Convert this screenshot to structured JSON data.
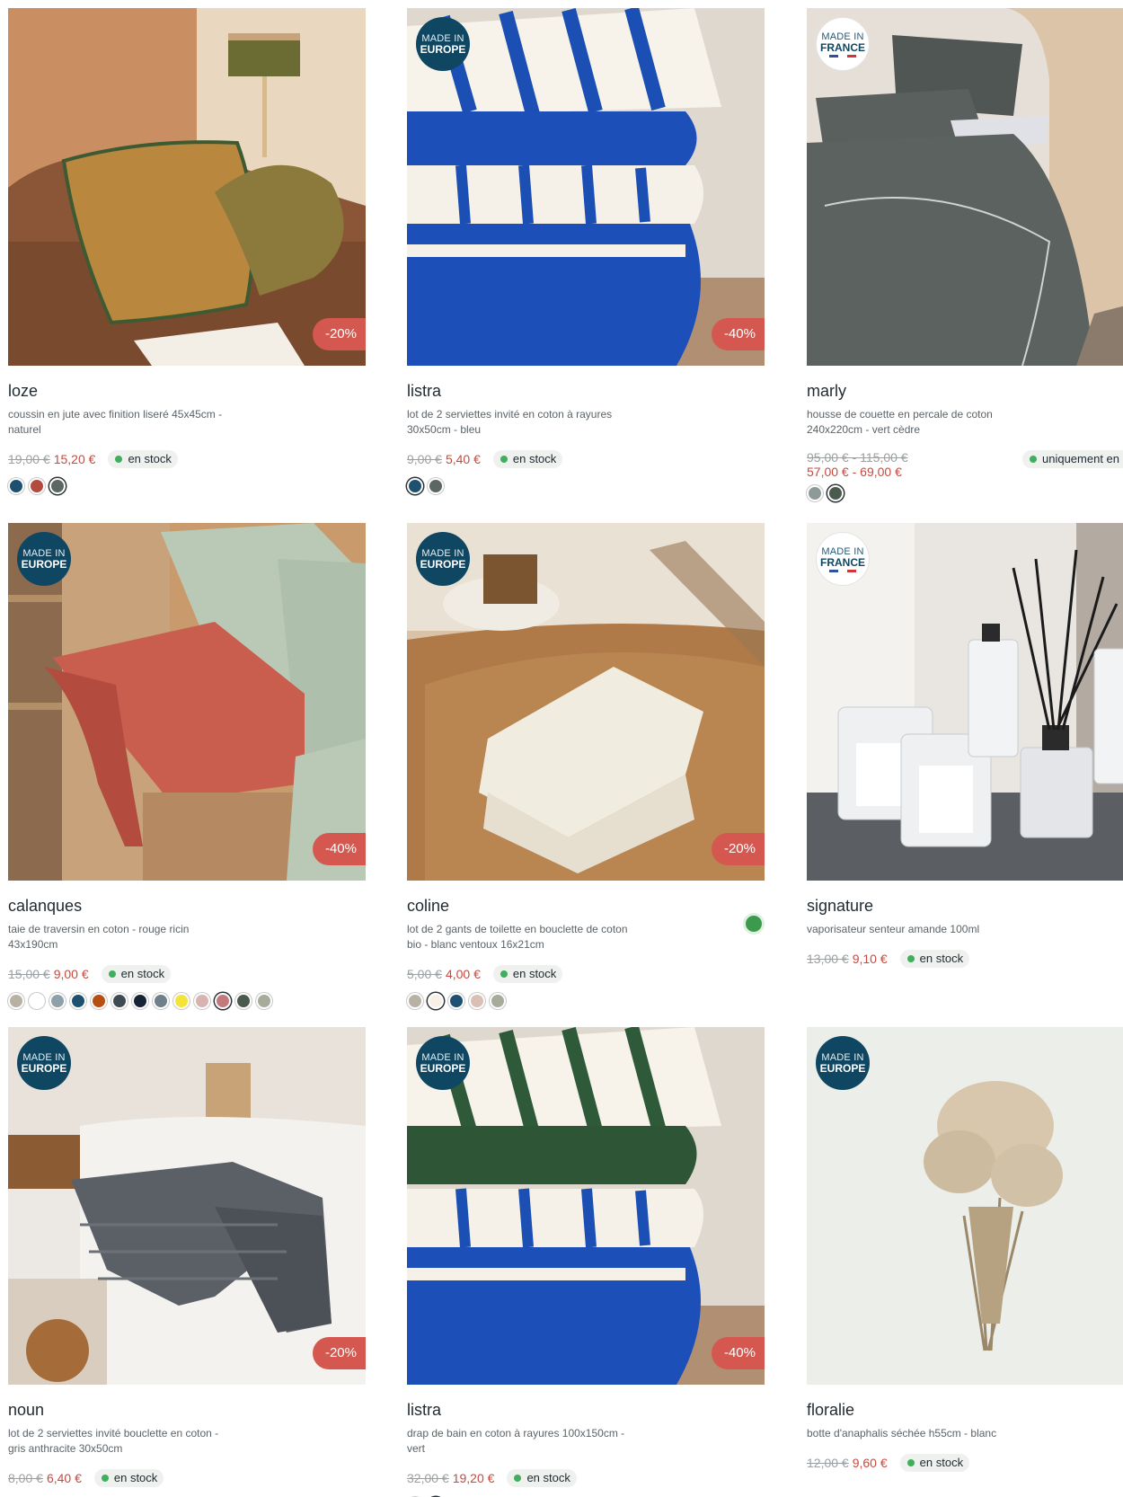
{
  "colors": {
    "accent_red": "#d4584f",
    "price_red": "#c9493e",
    "made_blue": "#0f4763",
    "stock_green": "#3fae5d"
  },
  "products": [
    {
      "name": "loze",
      "desc": "coussin en jute avec finition liseré 45x45cm - naturel",
      "old_price": "19,00 €",
      "new_price": "15,20 €",
      "stock": "en stock",
      "discount": "-20%",
      "made": null,
      "swatches": [
        "#1e5171",
        "#b34a3e",
        "#5d6660"
      ],
      "selected": 2
    },
    {
      "name": "listra",
      "desc": "lot de 2 serviettes invité en coton à rayures 30x50cm - bleu",
      "old_price": "9,00 €",
      "new_price": "5,40 €",
      "stock": "en stock",
      "discount": "-40%",
      "made": {
        "line1": "MADE IN",
        "line2": "EUROPE"
      },
      "swatches": [
        "#1e5171",
        "#5d6660"
      ],
      "selected": 0
    },
    {
      "name": "marly",
      "desc": "housse de couette en percale de coton 240x220cm - vert cèdre",
      "old_price": "95,00 € - 115,00 €",
      "new_price": "57,00 € - 69,00 €",
      "stock": "uniquement en m",
      "discount": "",
      "made": {
        "line1": "MADE IN",
        "line2": "FRANCE"
      },
      "swatches": [
        "#8d9a97",
        "#4b5a4f"
      ],
      "selected": 1
    },
    {
      "name": "calanques",
      "desc": "taie de traversin en coton - rouge ricin 43x190cm",
      "old_price": "15,00 €",
      "new_price": "9,00 €",
      "stock": "en stock",
      "discount": "-40%",
      "made": {
        "line1": "MADE IN",
        "line2": "EUROPE"
      },
      "swatches": [
        "#b7b2a4",
        "#ffffff",
        "#8ea0a8",
        "#1e5171",
        "#b84f12",
        "#3f4a55",
        "#172337",
        "#6f808a",
        "#f4e338",
        "#d8b4b0",
        "#c27a7a",
        "#4b5a4f",
        "#a6ab9a"
      ],
      "selected": 10
    },
    {
      "name": "coline",
      "desc": "lot de 2 gants de toilette en bouclette de coton bio - blanc ventoux 16x21cm",
      "old_price": "5,00 €",
      "new_price": "4,00 €",
      "stock": "en stock",
      "discount": "-20%",
      "made": {
        "line1": "MADE IN",
        "line2": "EUROPE"
      },
      "swatches": [
        "#b7b2a4",
        "#f6f1e4",
        "#1e5171",
        "#d8c1b4",
        "#a6ab9a"
      ],
      "selected": 1,
      "eco": true
    },
    {
      "name": "signature",
      "desc": "vaporisateur senteur amande 100ml",
      "old_price": "13,00 €",
      "new_price": "9,10 €",
      "stock": "en stock",
      "discount": "",
      "made": {
        "line1": "MADE IN",
        "line2": "FRANCE"
      },
      "swatches": [],
      "selected": -1
    },
    {
      "name": "noun",
      "desc": "lot de 2 serviettes invité bouclette en coton - gris anthracite 30x50cm",
      "old_price": "8,00 €",
      "new_price": "6,40 €",
      "stock": "en stock",
      "discount": "-20%",
      "made": {
        "line1": "MADE IN",
        "line2": "EUROPE"
      },
      "swatches": [],
      "selected": -1
    },
    {
      "name": "listra",
      "desc": "drap de bain en coton à rayures 100x150cm - vert",
      "old_price": "32,00 €",
      "new_price": "19,20 €",
      "stock": "en stock",
      "discount": "-40%",
      "made": {
        "line1": "MADE IN",
        "line2": "EUROPE"
      },
      "swatches": [
        "#1e5171",
        "#4b5a4f"
      ],
      "selected": 1
    },
    {
      "name": "floralie",
      "desc": "botte d'anaphalis séchée h55cm - blanc",
      "old_price": "12,00 €",
      "new_price": "9,60 €",
      "stock": "en stock",
      "discount": "",
      "made": {
        "line1": "MADE IN",
        "line2": "EUROPE"
      },
      "swatches": [],
      "selected": -1
    }
  ]
}
